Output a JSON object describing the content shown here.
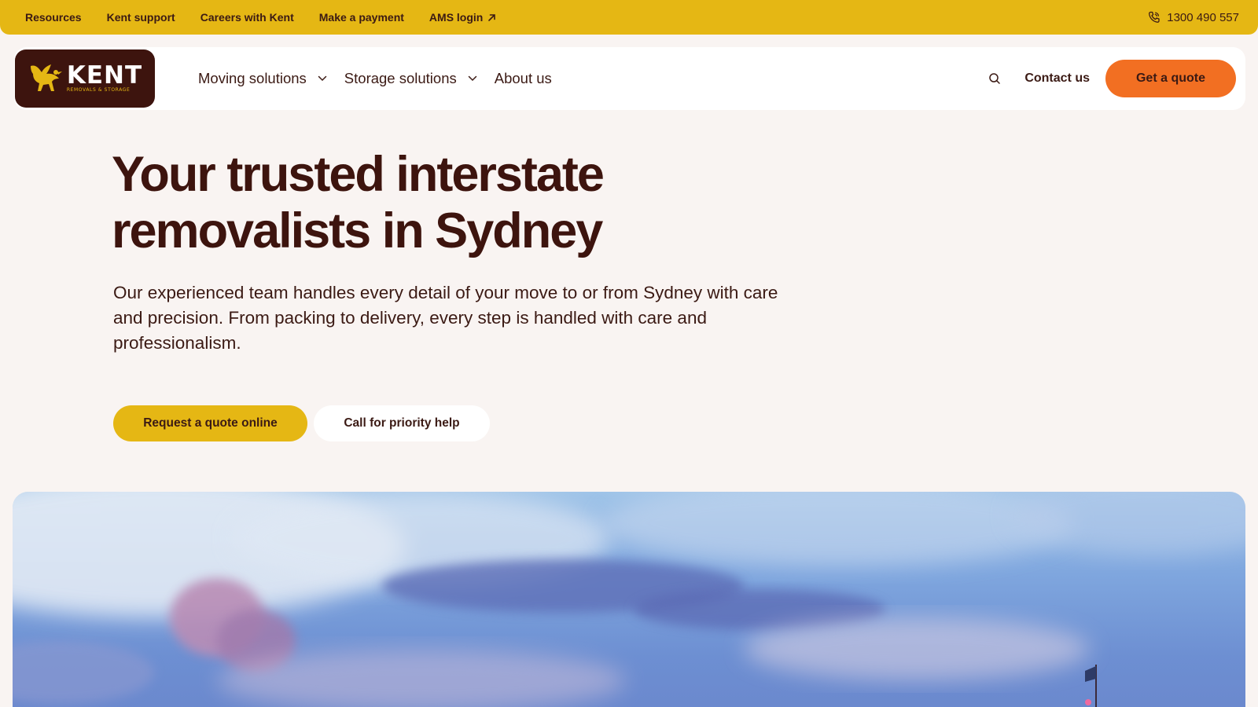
{
  "topbar": {
    "links": [
      {
        "label": "Resources"
      },
      {
        "label": "Kent support"
      },
      {
        "label": "Careers with Kent"
      },
      {
        "label": "Make a payment"
      },
      {
        "label": "AMS login",
        "external": true
      }
    ],
    "phone": "1300 490 557",
    "icons": {
      "phone": "phone-icon",
      "external": "arrow-up-right-icon"
    }
  },
  "nav": {
    "logo": {
      "word": "KENT",
      "sub": "REMOVALS & STORAGE",
      "icon": "griffin-logo-icon"
    },
    "menu": [
      {
        "label": "Moving solutions",
        "dropdown": true
      },
      {
        "label": "Storage solutions",
        "dropdown": true
      },
      {
        "label": "About us",
        "dropdown": false
      }
    ],
    "contact": "Contact us",
    "quote": "Get a quote",
    "icons": {
      "search": "search-icon",
      "chevron": "chevron-down-icon"
    }
  },
  "hero": {
    "title": "Your trusted interstate removalists in Sydney",
    "description": "Our experienced team handles every detail of your move to or from Sydney with care and precision. From packing to delivery, every step is handled with care and professionalism.",
    "primary_cta": "Request a quote online",
    "secondary_cta": "Call for priority help"
  },
  "colors": {
    "topbar": "#e5b714",
    "brand_dark": "#3d140e",
    "accent_orange": "#f26f22",
    "page_bg": "#f9f4f2"
  }
}
